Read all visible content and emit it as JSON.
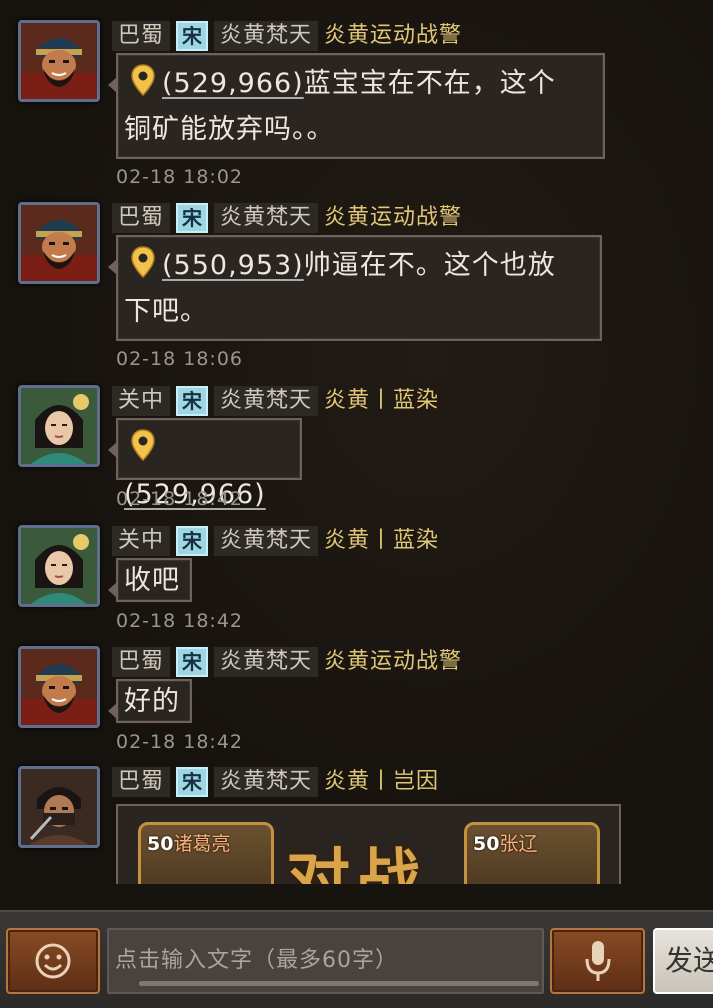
{
  "messages": [
    {
      "region": "巴蜀",
      "faction": "宋",
      "alliance": "炎黄梵天",
      "sender": "炎黄运动战警",
      "avatar_icon": "bearded-general-portrait",
      "coord": "(529,966)",
      "text": "蓝宝宝在不在，这个",
      "text2": "铜矿能放弃吗。。",
      "time": "02-18 18:02"
    },
    {
      "region": "巴蜀",
      "faction": "宋",
      "alliance": "炎黄梵天",
      "sender": "炎黄运动战警",
      "avatar_icon": "bearded-general-portrait",
      "coord": "(550,953)",
      "text": "帅逼在不。这个也放",
      "text2": "下吧。",
      "time": "02-18 18:06"
    },
    {
      "region": "关中",
      "faction": "宋",
      "alliance": "炎黄梵天",
      "sender": "炎黄丨蓝染",
      "avatar_icon": "lady-portrait",
      "coord": "(529,966)",
      "time": "02-18 18:42"
    },
    {
      "region": "关中",
      "faction": "宋",
      "alliance": "炎黄梵天",
      "sender": "炎黄丨蓝染",
      "avatar_icon": "lady-portrait",
      "text": "收吧",
      "time": "02-18 18:42"
    },
    {
      "region": "巴蜀",
      "faction": "宋",
      "alliance": "炎黄梵天",
      "sender": "炎黄运动战警",
      "avatar_icon": "bearded-general-portrait",
      "text": "好的",
      "time": "02-18 18:42"
    },
    {
      "region": "巴蜀",
      "faction": "宋",
      "alliance": "炎黄梵天",
      "sender": "炎黄丨岂因",
      "avatar_icon": "masked-warrior-portrait",
      "card_left": {
        "level": "50",
        "name": "诸葛亮"
      },
      "card_right": {
        "level": "50",
        "name": "张辽"
      },
      "duel_text": "对战"
    }
  ],
  "input": {
    "emoji_icon": "smiley-icon",
    "placeholder": "点击输入文字（最多60字）",
    "mic_icon": "microphone-icon",
    "send_label": "发送"
  },
  "colors": {
    "alliance_name": "#e0c776",
    "faction_badge": "#9fd6e6",
    "bubble_border": "#6e625a",
    "button_brown": "#7a4120"
  }
}
